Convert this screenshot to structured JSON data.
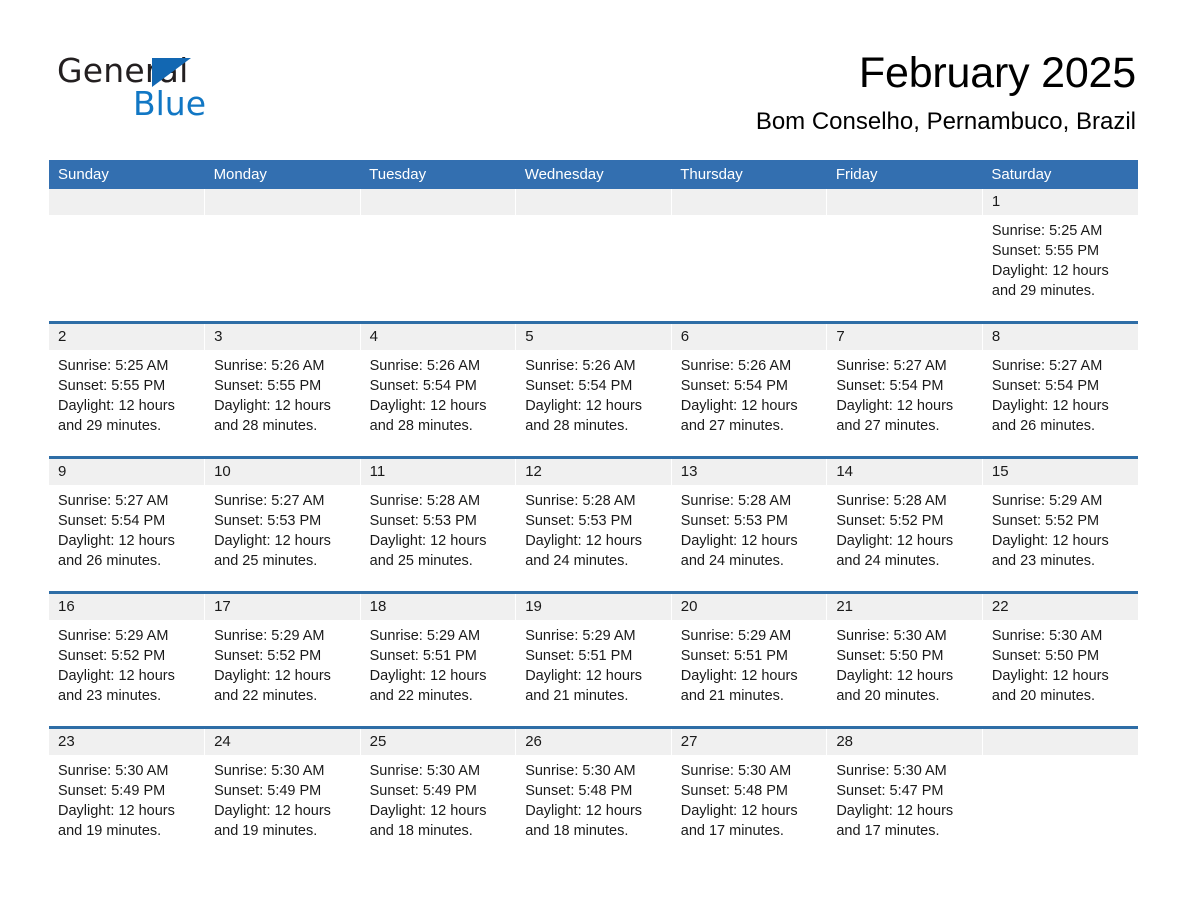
{
  "brand": {
    "logo_line1": "General",
    "logo_line2": "Blue",
    "logo_triangle_icon": "triangle-icon",
    "accent_color": "#1177c4",
    "header_color": "#336fb0"
  },
  "header": {
    "title": "February 2025",
    "subtitle": "Bom Conselho, Pernambuco, Brazil"
  },
  "calendar": {
    "weekday_headers": [
      "Sunday",
      "Monday",
      "Tuesday",
      "Wednesday",
      "Thursday",
      "Friday",
      "Saturday"
    ],
    "weeks": [
      [
        {
          "day": "",
          "sunrise": "",
          "sunset": "",
          "daylight_line1": "",
          "daylight_line2": ""
        },
        {
          "day": "",
          "sunrise": "",
          "sunset": "",
          "daylight_line1": "",
          "daylight_line2": ""
        },
        {
          "day": "",
          "sunrise": "",
          "sunset": "",
          "daylight_line1": "",
          "daylight_line2": ""
        },
        {
          "day": "",
          "sunrise": "",
          "sunset": "",
          "daylight_line1": "",
          "daylight_line2": ""
        },
        {
          "day": "",
          "sunrise": "",
          "sunset": "",
          "daylight_line1": "",
          "daylight_line2": ""
        },
        {
          "day": "",
          "sunrise": "",
          "sunset": "",
          "daylight_line1": "",
          "daylight_line2": ""
        },
        {
          "day": "1",
          "sunrise": "Sunrise: 5:25 AM",
          "sunset": "Sunset: 5:55 PM",
          "daylight_line1": "Daylight: 12 hours",
          "daylight_line2": "and 29 minutes."
        }
      ],
      [
        {
          "day": "2",
          "sunrise": "Sunrise: 5:25 AM",
          "sunset": "Sunset: 5:55 PM",
          "daylight_line1": "Daylight: 12 hours",
          "daylight_line2": "and 29 minutes."
        },
        {
          "day": "3",
          "sunrise": "Sunrise: 5:26 AM",
          "sunset": "Sunset: 5:55 PM",
          "daylight_line1": "Daylight: 12 hours",
          "daylight_line2": "and 28 minutes."
        },
        {
          "day": "4",
          "sunrise": "Sunrise: 5:26 AM",
          "sunset": "Sunset: 5:54 PM",
          "daylight_line1": "Daylight: 12 hours",
          "daylight_line2": "and 28 minutes."
        },
        {
          "day": "5",
          "sunrise": "Sunrise: 5:26 AM",
          "sunset": "Sunset: 5:54 PM",
          "daylight_line1": "Daylight: 12 hours",
          "daylight_line2": "and 28 minutes."
        },
        {
          "day": "6",
          "sunrise": "Sunrise: 5:26 AM",
          "sunset": "Sunset: 5:54 PM",
          "daylight_line1": "Daylight: 12 hours",
          "daylight_line2": "and 27 minutes."
        },
        {
          "day": "7",
          "sunrise": "Sunrise: 5:27 AM",
          "sunset": "Sunset: 5:54 PM",
          "daylight_line1": "Daylight: 12 hours",
          "daylight_line2": "and 27 minutes."
        },
        {
          "day": "8",
          "sunrise": "Sunrise: 5:27 AM",
          "sunset": "Sunset: 5:54 PM",
          "daylight_line1": "Daylight: 12 hours",
          "daylight_line2": "and 26 minutes."
        }
      ],
      [
        {
          "day": "9",
          "sunrise": "Sunrise: 5:27 AM",
          "sunset": "Sunset: 5:54 PM",
          "daylight_line1": "Daylight: 12 hours",
          "daylight_line2": "and 26 minutes."
        },
        {
          "day": "10",
          "sunrise": "Sunrise: 5:27 AM",
          "sunset": "Sunset: 5:53 PM",
          "daylight_line1": "Daylight: 12 hours",
          "daylight_line2": "and 25 minutes."
        },
        {
          "day": "11",
          "sunrise": "Sunrise: 5:28 AM",
          "sunset": "Sunset: 5:53 PM",
          "daylight_line1": "Daylight: 12 hours",
          "daylight_line2": "and 25 minutes."
        },
        {
          "day": "12",
          "sunrise": "Sunrise: 5:28 AM",
          "sunset": "Sunset: 5:53 PM",
          "daylight_line1": "Daylight: 12 hours",
          "daylight_line2": "and 24 minutes."
        },
        {
          "day": "13",
          "sunrise": "Sunrise: 5:28 AM",
          "sunset": "Sunset: 5:53 PM",
          "daylight_line1": "Daylight: 12 hours",
          "daylight_line2": "and 24 minutes."
        },
        {
          "day": "14",
          "sunrise": "Sunrise: 5:28 AM",
          "sunset": "Sunset: 5:52 PM",
          "daylight_line1": "Daylight: 12 hours",
          "daylight_line2": "and 24 minutes."
        },
        {
          "day": "15",
          "sunrise": "Sunrise: 5:29 AM",
          "sunset": "Sunset: 5:52 PM",
          "daylight_line1": "Daylight: 12 hours",
          "daylight_line2": "and 23 minutes."
        }
      ],
      [
        {
          "day": "16",
          "sunrise": "Sunrise: 5:29 AM",
          "sunset": "Sunset: 5:52 PM",
          "daylight_line1": "Daylight: 12 hours",
          "daylight_line2": "and 23 minutes."
        },
        {
          "day": "17",
          "sunrise": "Sunrise: 5:29 AM",
          "sunset": "Sunset: 5:52 PM",
          "daylight_line1": "Daylight: 12 hours",
          "daylight_line2": "and 22 minutes."
        },
        {
          "day": "18",
          "sunrise": "Sunrise: 5:29 AM",
          "sunset": "Sunset: 5:51 PM",
          "daylight_line1": "Daylight: 12 hours",
          "daylight_line2": "and 22 minutes."
        },
        {
          "day": "19",
          "sunrise": "Sunrise: 5:29 AM",
          "sunset": "Sunset: 5:51 PM",
          "daylight_line1": "Daylight: 12 hours",
          "daylight_line2": "and 21 minutes."
        },
        {
          "day": "20",
          "sunrise": "Sunrise: 5:29 AM",
          "sunset": "Sunset: 5:51 PM",
          "daylight_line1": "Daylight: 12 hours",
          "daylight_line2": "and 21 minutes."
        },
        {
          "day": "21",
          "sunrise": "Sunrise: 5:30 AM",
          "sunset": "Sunset: 5:50 PM",
          "daylight_line1": "Daylight: 12 hours",
          "daylight_line2": "and 20 minutes."
        },
        {
          "day": "22",
          "sunrise": "Sunrise: 5:30 AM",
          "sunset": "Sunset: 5:50 PM",
          "daylight_line1": "Daylight: 12 hours",
          "daylight_line2": "and 20 minutes."
        }
      ],
      [
        {
          "day": "23",
          "sunrise": "Sunrise: 5:30 AM",
          "sunset": "Sunset: 5:49 PM",
          "daylight_line1": "Daylight: 12 hours",
          "daylight_line2": "and 19 minutes."
        },
        {
          "day": "24",
          "sunrise": "Sunrise: 5:30 AM",
          "sunset": "Sunset: 5:49 PM",
          "daylight_line1": "Daylight: 12 hours",
          "daylight_line2": "and 19 minutes."
        },
        {
          "day": "25",
          "sunrise": "Sunrise: 5:30 AM",
          "sunset": "Sunset: 5:49 PM",
          "daylight_line1": "Daylight: 12 hours",
          "daylight_line2": "and 18 minutes."
        },
        {
          "day": "26",
          "sunrise": "Sunrise: 5:30 AM",
          "sunset": "Sunset: 5:48 PM",
          "daylight_line1": "Daylight: 12 hours",
          "daylight_line2": "and 18 minutes."
        },
        {
          "day": "27",
          "sunrise": "Sunrise: 5:30 AM",
          "sunset": "Sunset: 5:48 PM",
          "daylight_line1": "Daylight: 12 hours",
          "daylight_line2": "and 17 minutes."
        },
        {
          "day": "28",
          "sunrise": "Sunrise: 5:30 AM",
          "sunset": "Sunset: 5:47 PM",
          "daylight_line1": "Daylight: 12 hours",
          "daylight_line2": "and 17 minutes."
        },
        {
          "day": "",
          "sunrise": "",
          "sunset": "",
          "daylight_line1": "",
          "daylight_line2": ""
        }
      ]
    ]
  }
}
